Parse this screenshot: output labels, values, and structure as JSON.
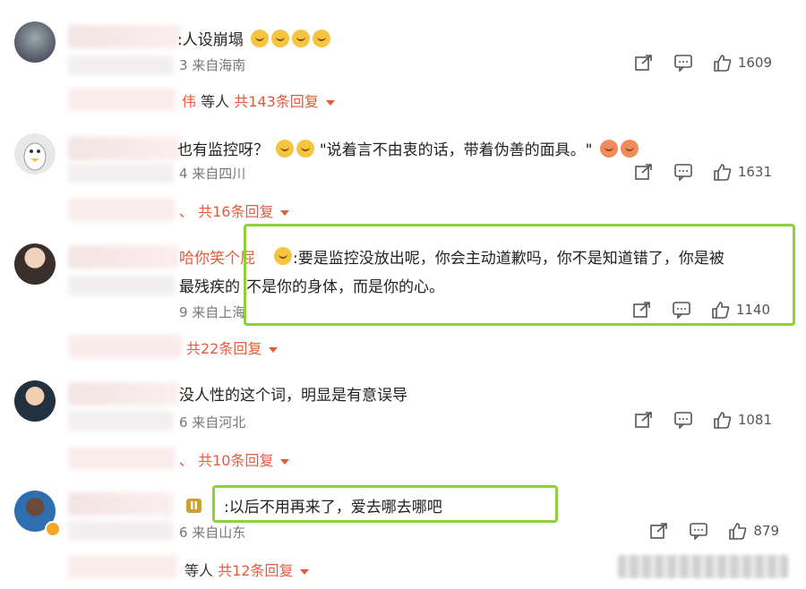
{
  "comments": [
    {
      "text": "人设崩塌",
      "text_prefix": ":",
      "meta": "3 来自海南",
      "share_label": "",
      "comment_label": "",
      "likes": "1609",
      "reply_who": "伟",
      "reply_plain": "等人",
      "reply_count": "共143条回复"
    },
    {
      "text": "\"说着言不由衷的话，带着伪善的面具。\"",
      "text_prefix": "也有监控呀？",
      "meta": "4 来自四川",
      "likes": "1631",
      "reply_who": "、",
      "reply_count": "共16条回复"
    },
    {
      "name_fragment": "哈你笑个屁",
      "text_line1": ":要是监控没放出呢，你会主动道歉吗，你不是知道错了，你是被",
      "text_line2_prefix": "最残疾的",
      "text_line2": "不是你的身体，而是你的心。",
      "meta": "9 来自上海",
      "likes": "1140",
      "reply_count": "共22条回复"
    },
    {
      "text": "没人性的这个词，明显是有意误导",
      "meta": "6 来自河北",
      "likes": "1081",
      "reply_who": "、",
      "reply_count": "共10条回复"
    },
    {
      "badge": "II",
      "text": ":以后不用再来了，爱去哪去哪吧",
      "meta": "6 来自山东",
      "likes": "879",
      "reply_plain": "等人",
      "reply_count": "共12条回复"
    }
  ],
  "colors": {
    "accent": "#e55b3c",
    "highlight": "#8dd13a",
    "text": "#222222",
    "meta": "#777777"
  },
  "icons": [
    "share-icon",
    "comment-icon",
    "like-icon",
    "emoji-icon",
    "caret-down-icon"
  ]
}
